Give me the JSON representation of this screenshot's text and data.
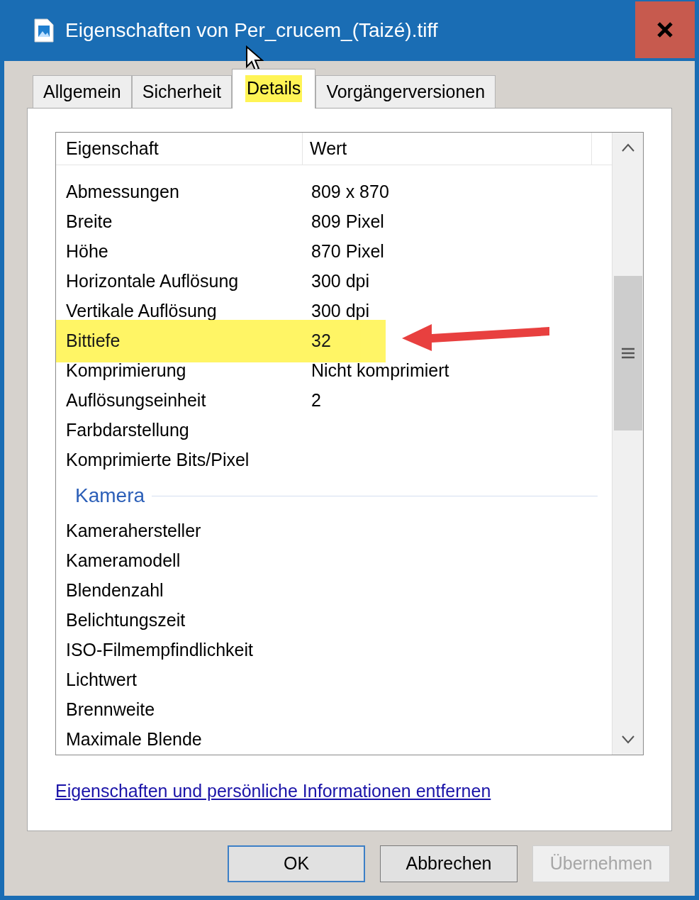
{
  "window": {
    "title": "Eigenschaften von Per_crucem_(Taizé).tiff"
  },
  "tabs": [
    {
      "label": "Allgemein",
      "selected": false,
      "highlighted": false
    },
    {
      "label": "Sicherheit",
      "selected": false,
      "highlighted": false
    },
    {
      "label": "Details",
      "selected": true,
      "highlighted": true
    },
    {
      "label": "Vorgängerversionen",
      "selected": false,
      "highlighted": false
    }
  ],
  "table": {
    "columns": [
      "Eigenschaft",
      "Wert"
    ],
    "rows": [
      {
        "kind": "row",
        "name": "Abmessungen",
        "value": "809 x 870",
        "highlighted": false
      },
      {
        "kind": "row",
        "name": "Breite",
        "value": "809 Pixel",
        "highlighted": false
      },
      {
        "kind": "row",
        "name": "Höhe",
        "value": "870 Pixel",
        "highlighted": false
      },
      {
        "kind": "row",
        "name": "Horizontale Auflösung",
        "value": "300 dpi",
        "highlighted": false
      },
      {
        "kind": "row",
        "name": "Vertikale Auflösung",
        "value": "300 dpi",
        "highlighted": false
      },
      {
        "kind": "row",
        "name": "Bittiefe",
        "value": "32",
        "highlighted": true
      },
      {
        "kind": "row",
        "name": "Komprimierung",
        "value": "Nicht komprimiert",
        "highlighted": false
      },
      {
        "kind": "row",
        "name": "Auflösungseinheit",
        "value": "2",
        "highlighted": false
      },
      {
        "kind": "row",
        "name": "Farbdarstellung",
        "highlighted": false
      },
      {
        "kind": "row",
        "name": "Komprimierte Bits/Pixel",
        "highlighted": false
      },
      {
        "kind": "group",
        "name": "Kamera"
      },
      {
        "kind": "row",
        "name": "Kamerahersteller",
        "highlighted": false
      },
      {
        "kind": "row",
        "name": "Kameramodell",
        "highlighted": false
      },
      {
        "kind": "row",
        "name": "Blendenzahl",
        "highlighted": false
      },
      {
        "kind": "row",
        "name": "Belichtungszeit",
        "highlighted": false
      },
      {
        "kind": "row",
        "name": "ISO-Filmempfindlichkeit",
        "highlighted": false
      },
      {
        "kind": "row",
        "name": "Lichtwert",
        "highlighted": false
      },
      {
        "kind": "row",
        "name": "Brennweite",
        "highlighted": false
      },
      {
        "kind": "row",
        "name": "Maximale Blende",
        "highlighted": false
      }
    ]
  },
  "link": "Eigenschaften und persönliche Informationen entfernen",
  "buttons": [
    {
      "label": "OK",
      "default": true,
      "disabled": false
    },
    {
      "label": "Abbrechen",
      "default": false,
      "disabled": false
    },
    {
      "label": "Übernehmen",
      "default": false,
      "disabled": true
    }
  ]
}
